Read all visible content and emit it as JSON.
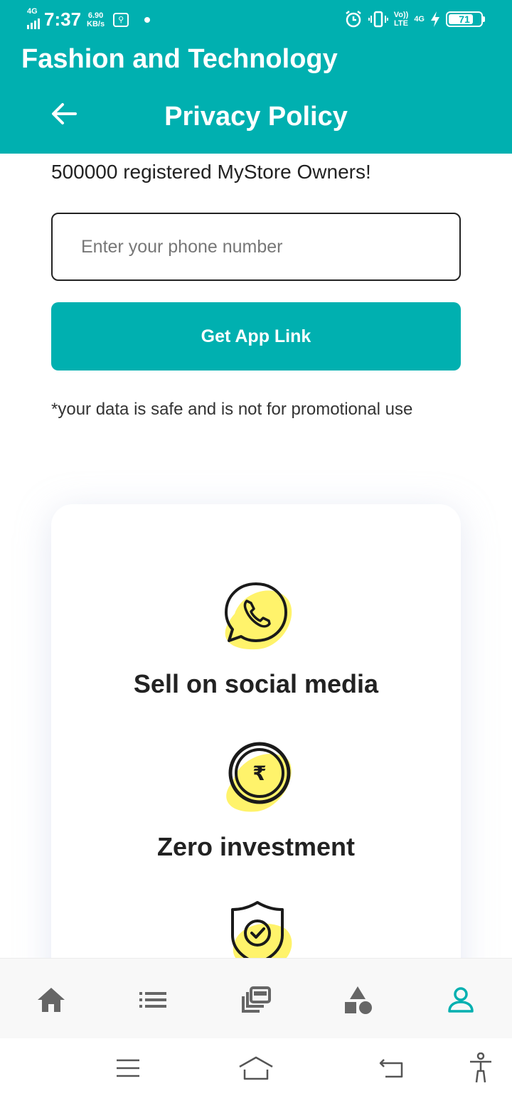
{
  "status_bar": {
    "network_small": "4G",
    "time": "7:37",
    "speed_value": "6.90",
    "speed_unit": "KB/s",
    "volte_top": "Vo))",
    "volte_bottom": "LTE",
    "network_right": "4G",
    "battery_level": "71"
  },
  "header": {
    "app_title": "Fashion and Technology",
    "page_title": "Privacy Policy",
    "color": "#00b0b0"
  },
  "content": {
    "registered_text": "500000 registered MyStore Owners!",
    "phone_placeholder": "Enter your phone number",
    "cta_label": "Get App Link",
    "disclaimer": "*your data is safe and is not for promotional use"
  },
  "features": [
    {
      "icon": "whatsapp-icon",
      "label": "Sell on social media"
    },
    {
      "icon": "rupee-coin-icon",
      "label": "Zero investment"
    },
    {
      "icon": "shield-check-icon",
      "label": ""
    }
  ],
  "bottom_nav": {
    "items": [
      {
        "icon": "home-icon",
        "active": false
      },
      {
        "icon": "list-icon",
        "active": false
      },
      {
        "icon": "catalog-icon",
        "active": false
      },
      {
        "icon": "categories-icon",
        "active": false
      },
      {
        "icon": "profile-icon",
        "active": true
      }
    ],
    "active_color": "#00b0b0",
    "inactive_color": "#666666"
  },
  "system_nav": [
    "menu-icon",
    "home-icon",
    "back-icon",
    "accessibility-icon"
  ],
  "accent_yellow": "#fff36b"
}
